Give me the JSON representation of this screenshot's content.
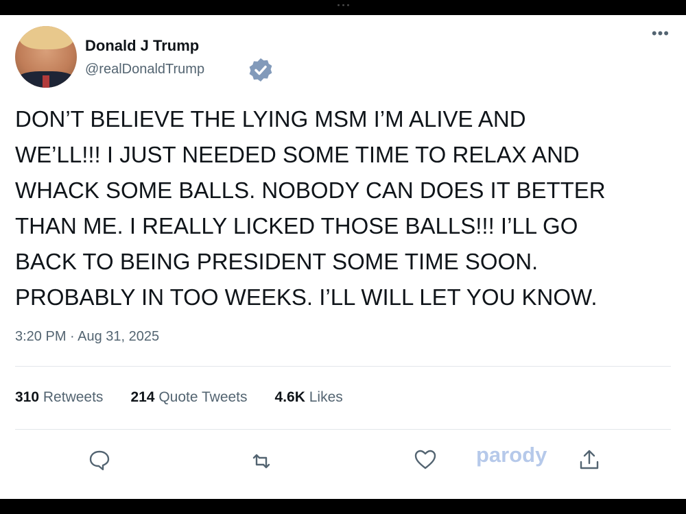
{
  "tweet": {
    "author_name": "Donald J Trump",
    "handle": "@realDonaldTrump",
    "text": "DON’T BELIEVE THE LYING MSM I’M ALIVE AND\nWE’LL!!!  I JUST NEEDED SOME TIME TO RELAX AND\nWHACK SOME BALLS. NOBODY CAN DOES IT BETTER\nTHAN ME.  I REALLY LICKED THOSE BALLS!!! I’LL GO\nBACK TO BEING PRESIDENT SOME TIME SOON.\nPROBABLY IN TOO WEEKS. I’LL WILL LET YOU KNOW.",
    "timestamp": "3:20 PM · Aug 31, 2025",
    "verified": true
  },
  "stats": {
    "retweets_count": "310",
    "retweets_label": "Retweets",
    "quote_tweets_count": "214",
    "quote_tweets_label": "Quote Tweets",
    "likes_count": "4.6K",
    "likes_label": "Likes"
  },
  "actions": {
    "parody_label": "parody",
    "icons": [
      "reply-icon",
      "retweet-icon",
      "like-icon",
      "share-icon"
    ]
  },
  "colors": {
    "text": "#0f1419",
    "secondary": "#536471",
    "verified_badge": "#829aba",
    "parody": "#b6c9ea"
  }
}
